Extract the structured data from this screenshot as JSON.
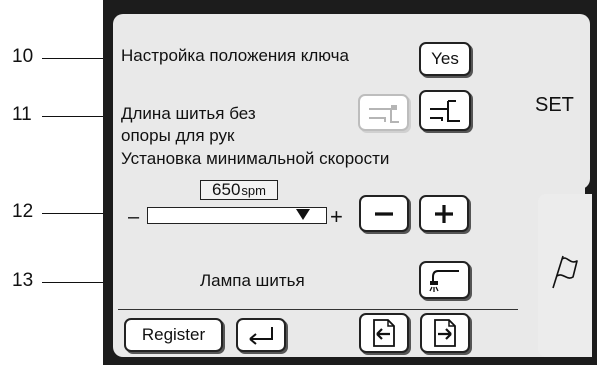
{
  "callouts": [
    {
      "number": "10"
    },
    {
      "number": "11"
    },
    {
      "number": "12"
    },
    {
      "number": "13"
    }
  ],
  "tabs": {
    "set_label": "SET"
  },
  "key_position": {
    "label": "Настройка положения ключа",
    "button_label": "Yes"
  },
  "no_arm_support": {
    "label_line1": "Длина шитья без",
    "label_line2": "опоры для рук"
  },
  "min_speed": {
    "label": "Установка минимальной скорости",
    "value_number": "650",
    "value_unit": "spm",
    "slider_minus": "–",
    "slider_plus": "+",
    "slider_level": 0.9
  },
  "lamp": {
    "label": "Лампа шитья"
  },
  "footer": {
    "register_label": "Register"
  },
  "icons": {
    "arm_support_off": "arm-support-off-icon",
    "arm_support_on": "arm-support-on-icon",
    "decrease": "minus-icon",
    "increase": "plus-icon",
    "lamp": "sewing-lamp-icon",
    "back": "return-arrow-icon",
    "page_in": "page-in-icon",
    "page_out": "page-out-icon",
    "flag": "flag-icon"
  }
}
